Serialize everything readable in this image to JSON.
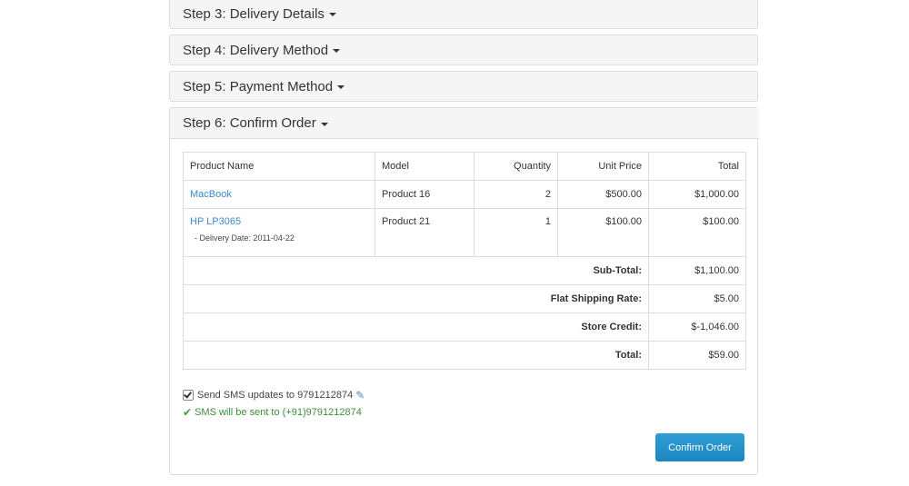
{
  "steps": [
    {
      "label": "Step 3: Delivery Details"
    },
    {
      "label": "Step 4: Delivery Method"
    },
    {
      "label": "Step 5: Payment Method"
    }
  ],
  "confirm": {
    "title": "Step 6: Confirm Order",
    "columns": [
      "Product Name",
      "Model",
      "Quantity",
      "Unit Price",
      "Total"
    ],
    "rows": [
      {
        "name": "MacBook",
        "model": "Product 16",
        "qty": "2",
        "unit": "$500.00",
        "total": "$1,000.00"
      },
      {
        "name": "HP LP3065",
        "note": " - Delivery Date: 2011-04-22",
        "model": "Product 21",
        "qty": "1",
        "unit": "$100.00",
        "total": "$100.00"
      }
    ],
    "totals": [
      {
        "label": "Sub-Total:",
        "value": "$1,100.00"
      },
      {
        "label": "Flat Shipping Rate:",
        "value": "$5.00"
      },
      {
        "label": "Store Credit:",
        "value": "$-1,046.00"
      },
      {
        "label": "Total:",
        "value": "$59.00"
      }
    ],
    "sms_label": "Send SMS updates to 9791212874",
    "sms_sent": "SMS will be sent to (+91)9791212874",
    "button": "Confirm Order"
  },
  "icons": {
    "caret": "caret-down-icon",
    "pencil": "pencil-icon",
    "check": "check-icon"
  },
  "colors": {
    "link": "#3a8ac6",
    "button": "#1c85bf",
    "success": "#3c8d3c"
  }
}
